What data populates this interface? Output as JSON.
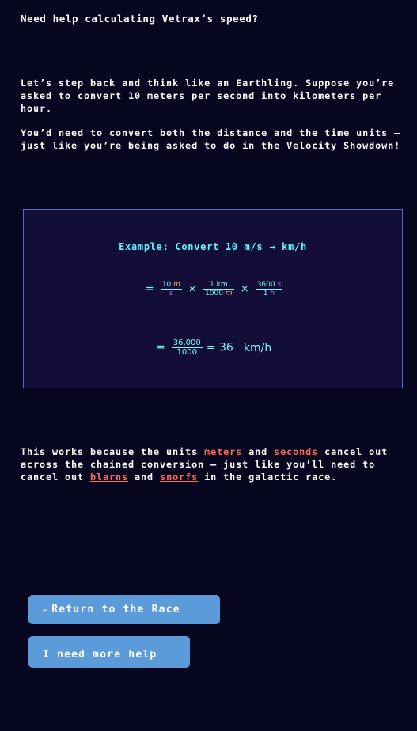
{
  "heading": "Need help calculating Vetrax’s speed?",
  "intro_paragraph": "Let’s step back and think like an Earthling. Suppose you’re asked to convert 10 meters per second into kilometers per hour.",
  "units_paragraph": "You’d need to convert both the distance and the time units — just like you’re being asked to do in the Velocity Showdown!",
  "example": {
    "title": "Example: Convert 10 m/s → km/h",
    "eq1": {
      "equals": "=",
      "f1_num_value": "10",
      "f1_num_unit": "m",
      "f1_den_unit": "s",
      "times1": "×",
      "f2_num_value": "1",
      "f2_num_unit": "km",
      "f2_den_value": "1000",
      "f2_den_unit": "m",
      "times2": "×",
      "f3_num_value": "3600",
      "f3_num_unit": "s",
      "f3_den_value": "1",
      "f3_den_unit": "h"
    },
    "eq2": {
      "equals": "=",
      "num": "36,000",
      "den": "1000",
      "equals2": "= 36",
      "unit": "km/h"
    }
  },
  "explanation": {
    "part1": "This works because the units ",
    "term1": "meters",
    "part2": " and ",
    "term2": "seconds",
    "part3": " cancel out across the chained conversion — just like you’ll need to cancel out ",
    "term3": "blarns",
    "part4": " and ",
    "term4": "snorfs",
    "part5": " in the galactic race."
  },
  "buttons": {
    "return_arrow": "←",
    "return_label": "Return to the Race",
    "help_label": "I need more help"
  },
  "colors": {
    "background": "#07061f",
    "highlight": "#ff6a59",
    "example_text": "#5ff5ff",
    "button": "#5b9bd9"
  }
}
